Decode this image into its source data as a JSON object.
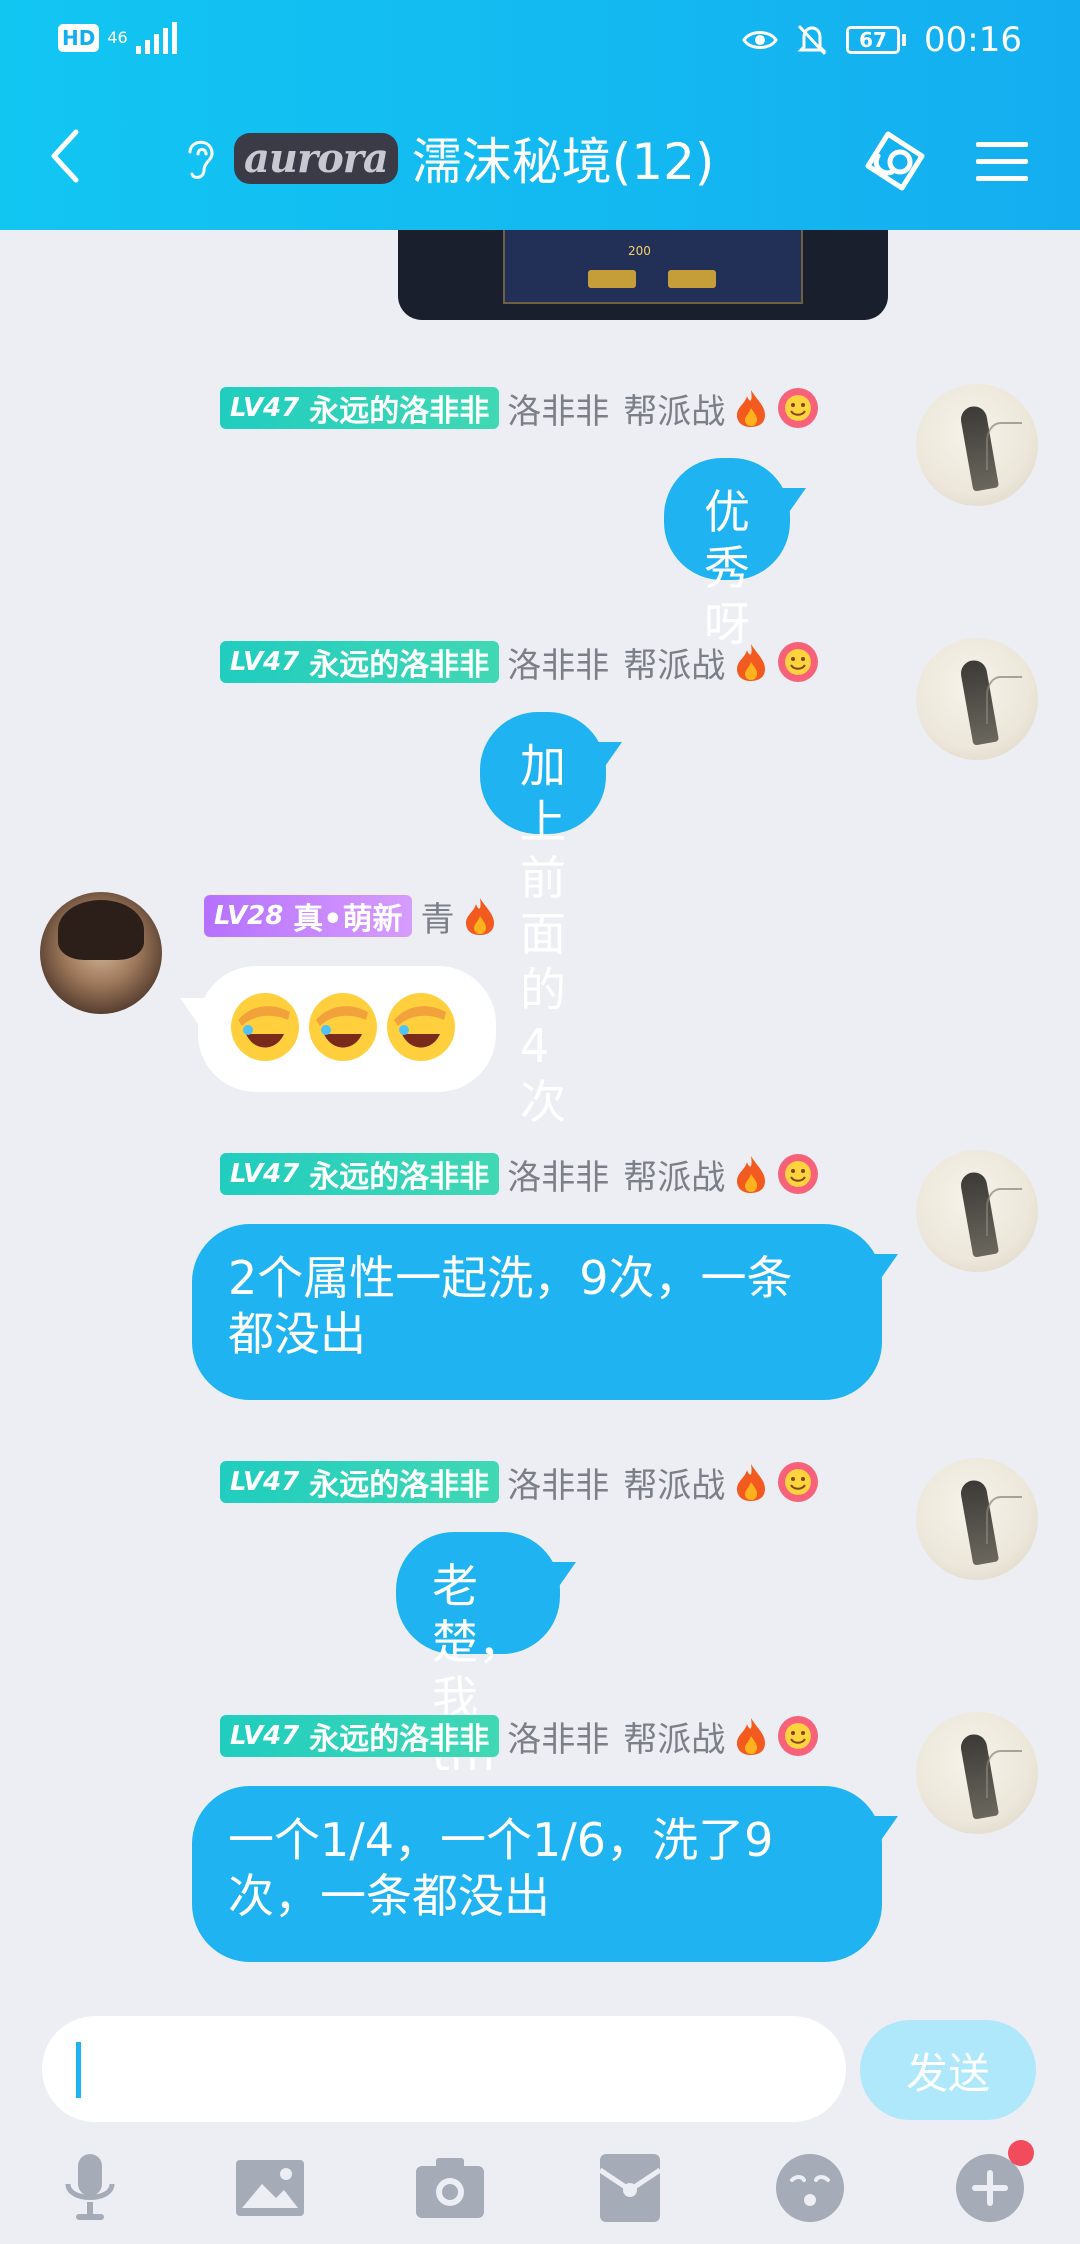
{
  "status_bar": {
    "hd": "HD",
    "network": "46",
    "battery": "67",
    "time": "00:16"
  },
  "header": {
    "logo_text": "aurora",
    "title": "濡沫秘境(12)"
  },
  "top_image": {
    "coin_value": "200"
  },
  "messages": [
    {
      "side": "right",
      "level": "LV47",
      "title_badge": "永远的洛非非",
      "name": "洛非非",
      "tag": "帮派战",
      "text": "优秀呀"
    },
    {
      "side": "right",
      "level": "LV47",
      "title_badge": "永远的洛非非",
      "name": "洛非非",
      "tag": "帮派战",
      "text": "加上前面的4次"
    },
    {
      "side": "left",
      "level": "LV28",
      "title_badge": "真•萌新",
      "name": "青",
      "text": ""
    },
    {
      "side": "right",
      "level": "LV47",
      "title_badge": "永远的洛非非",
      "name": "洛非非",
      "tag": "帮派战",
      "text_line1": "2个属性一起洗，9次，一条",
      "text_line2": "都没出"
    },
    {
      "side": "right",
      "level": "LV47",
      "title_badge": "永远的洛非非",
      "name": "洛非非",
      "tag": "帮派战",
      "text": "老楚，我tm谢谢你"
    },
    {
      "side": "right",
      "level": "LV47",
      "title_badge": "永远的洛非非",
      "name": "洛非非",
      "tag": "帮派战",
      "text_line1": "一个1/4，一个1/6，洗了9",
      "text_line2": "次，一条都没出"
    }
  ],
  "input": {
    "value": "",
    "send_label": "发送"
  },
  "toolbar": {
    "icons": [
      "microphone-icon",
      "image-icon",
      "camera-icon",
      "red-packet-icon",
      "emoji-icon",
      "plus-icon"
    ]
  },
  "colors": {
    "header_start": "#12c6f2",
    "header_end": "#14aef0",
    "bubble_blue": "#1fb3f2",
    "background": "#eceef4",
    "badge_teal": "#20cdbf",
    "badge_purple": "#b571ff"
  }
}
